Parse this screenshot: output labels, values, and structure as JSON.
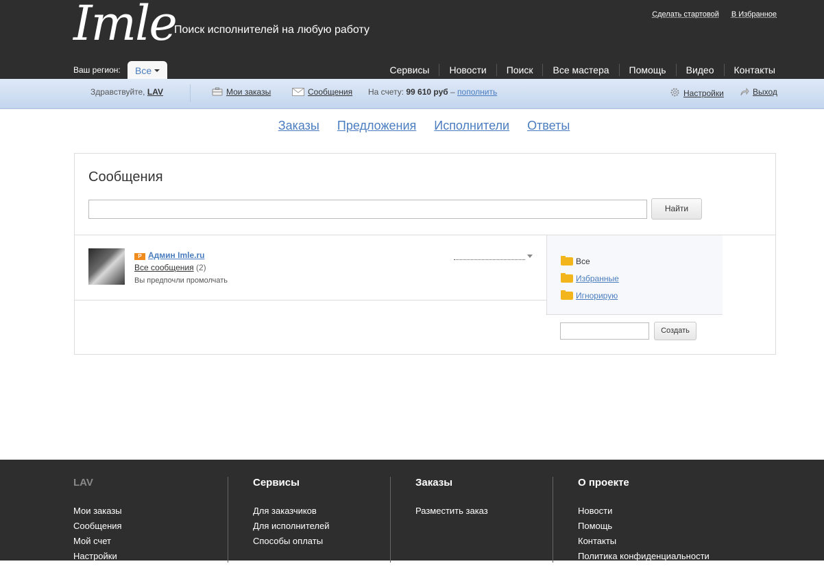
{
  "header": {
    "logo": "Imle",
    "tagline": "Поиск исполнителей на любую работу",
    "top_links": [
      "Сделать стартовой",
      "В Избранное"
    ],
    "region_label": "Ваш регион:",
    "region_value": "Все",
    "nav": [
      "Сервисы",
      "Новости",
      "Поиск",
      "Все мастера",
      "Помощь",
      "Видео",
      "Контакты"
    ]
  },
  "userbar": {
    "greeting": "Здравствуйте,",
    "username": "LAV",
    "my_orders": "Мои заказы",
    "messages": "Сообщения",
    "balance_label": "На счету:",
    "balance_value": "99 610 руб",
    "balance_dash": "–",
    "topup": "пополнить",
    "settings": "Настройки",
    "logout": "Выход"
  },
  "tabs": [
    "Заказы",
    "Предложения",
    "Исполнители",
    "Ответы"
  ],
  "messages_panel": {
    "title": "Сообщения",
    "search_value": "",
    "search_button": "Найти",
    "conversation": {
      "badge": "P",
      "author": "Админ Imle.ru",
      "all_messages": "Все сообщения",
      "count": "(2)",
      "preview": "Вы предпочли промолчать"
    },
    "folders": [
      "Все",
      "Избранные",
      "Игнорирую"
    ],
    "new_folder_value": "",
    "create_button": "Создать"
  },
  "footer": {
    "columns": [
      {
        "title": "LAV",
        "links": [
          "Мои заказы",
          "Сообщения",
          "Мой счет",
          "Настройки"
        ]
      },
      {
        "title": "Сервисы",
        "links": [
          "Для заказчиков",
          "Для исполнителей",
          "Способы оплаты"
        ]
      },
      {
        "title": "Заказы",
        "links": [
          "Разместить заказ"
        ]
      },
      {
        "title": "О проекте",
        "links": [
          "Новости",
          "Помощь",
          "Контакты",
          "Политика конфиденциальности"
        ]
      }
    ]
  },
  "colors": {
    "header_bg": "#2e2e2e",
    "link_blue": "#4a7dbf",
    "userbar_bg": "#c3d6ee",
    "folder_yellow": "#f3b51c"
  }
}
